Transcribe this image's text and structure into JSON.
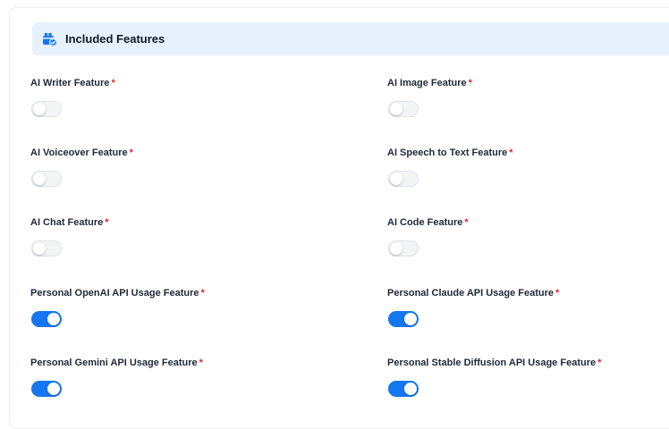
{
  "section": {
    "title": "Included Features",
    "icon": "gift-calendar-icon"
  },
  "required_marker": "*",
  "colors": {
    "accent": "#1477f0",
    "required": "#e3262a",
    "header_bg": "#e6f1fd"
  },
  "features": [
    {
      "label": "AI Writer Feature",
      "enabled": false
    },
    {
      "label": "AI Image Feature",
      "enabled": false
    },
    {
      "label": "AI Voiceover Feature",
      "enabled": false
    },
    {
      "label": "AI Speech to Text Feature",
      "enabled": false
    },
    {
      "label": "AI Chat Feature",
      "enabled": false
    },
    {
      "label": "AI Code Feature",
      "enabled": false
    },
    {
      "label": "Personal OpenAI API Usage Feature",
      "enabled": true
    },
    {
      "label": "Personal Claude API Usage Feature",
      "enabled": true
    },
    {
      "label": "Personal Gemini API Usage Feature",
      "enabled": true
    },
    {
      "label": "Personal Stable Diffusion API Usage Feature",
      "enabled": true
    }
  ]
}
